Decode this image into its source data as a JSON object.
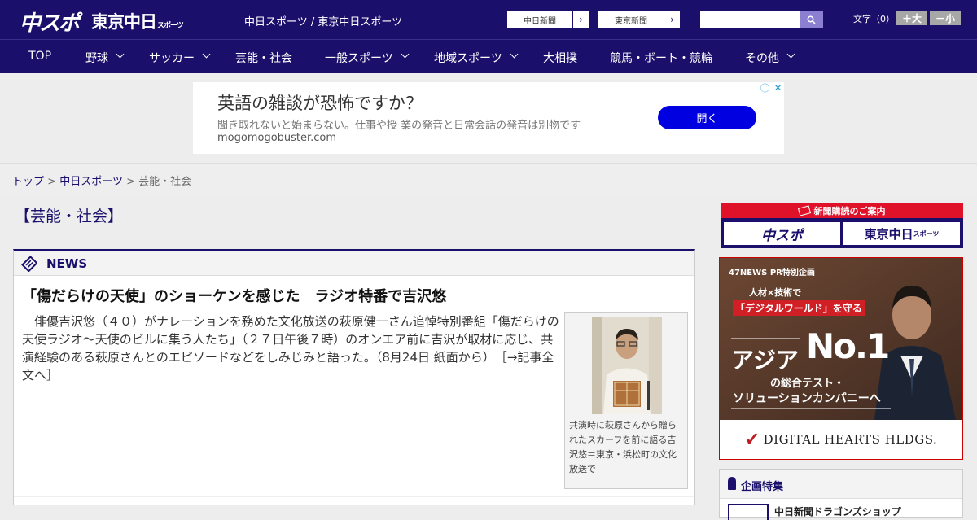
{
  "header": {
    "logo_chuspo": "中スポ",
    "logo_tokyo": "東京中日",
    "logo_tokyo_small": "スポーツ",
    "site_name": "中日スポーツ / 東京中日スポーツ",
    "paper_buttons": [
      "中日新聞",
      "東京新聞"
    ],
    "search_placeholder": "",
    "font_size_label": "文字（0）",
    "font_bigger": "＋大",
    "font_smaller": "－小"
  },
  "nav": {
    "items": [
      {
        "label": "TOP"
      },
      {
        "label": "野球"
      },
      {
        "label": "サッカー"
      },
      {
        "label": "芸能・社会"
      },
      {
        "label": "一般スポーツ"
      },
      {
        "label": "地域スポーツ"
      },
      {
        "label": "大相撲"
      },
      {
        "label": "競馬・ボート・競輪"
      },
      {
        "label": "その他"
      }
    ]
  },
  "ad": {
    "title": "英語の雑談が恐怖ですか？",
    "subtitle": "聞き取れないと始まらない。仕事や授 業の発音と日常会話の発音は別物です",
    "domain": "mogomogobuster.com",
    "button": "開く"
  },
  "breadcrumb": {
    "home": "トップ",
    "section": "中日スポーツ",
    "current": "芸能・社会",
    "sep": ">"
  },
  "category_title": "【芸能・社会】",
  "news": {
    "label": "NEWS",
    "headline": "「傷だらけの天使」のショーケンを感じた　ラジオ特番で吉沢悠",
    "body": "　俳優吉沢悠（４０）がナレーションを務めた文化放送の萩原健一さん追悼特別番組「傷だらけの天使ラジオ～天使のビルに集う人たち」（２７日午後７時）のオンエア前に吉沢が取材に応じ、共演経験のある萩原さんとのエピソードなどをしみじみと語った。（8月24日 紙面から）",
    "more_link": "［→記事全文へ］",
    "photo_caption": "共演時に萩原さんから贈られたスカーフを前に語る吉沢悠＝東京・浜松町の文化放送で"
  },
  "sidebar": {
    "subscribe_head": "新聞購読のご案内",
    "subscribe_buttons": [
      "中スポ",
      "東京中日"
    ],
    "subscribe_small": "スポーツ",
    "bigad": {
      "tag": "47NEWS PR特別企画",
      "line1": "人材×技術で",
      "line2": "「デジタルワールド」を守る",
      "asia": "アジア",
      "no1": "No.1",
      "line3": "の総合テスト・",
      "line4": "ソリューションカンパニーへ",
      "brand": "DIGITAL HEARTS HLDGS."
    },
    "feature_title": "企画特集",
    "feature_item": "中日新聞ドラゴンズショップ"
  },
  "colors": {
    "navy": "#1a0f6b",
    "red": "#e0122a",
    "ad_button": "#0000e0"
  }
}
